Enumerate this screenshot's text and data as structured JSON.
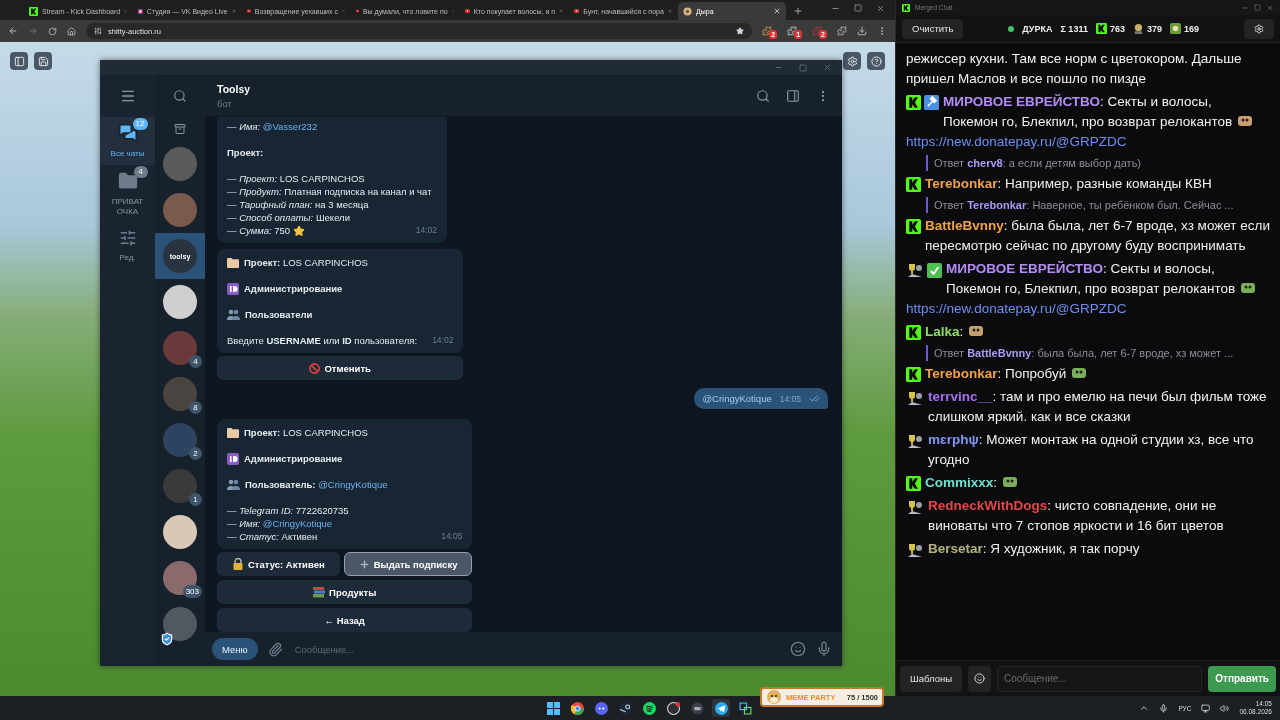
{
  "browser": {
    "tabs": [
      {
        "kind": "kick",
        "title": "Stream - Kick Dashboard",
        "selected": false
      },
      {
        "kind": "studio",
        "title": "Студия — VK Видео Live",
        "selected": false
      },
      {
        "kind": "video",
        "title": "Возвращение уехавших с",
        "selected": false
      },
      {
        "kind": "video",
        "title": "Вы думали, что ловите по",
        "selected": false
      },
      {
        "kind": "video",
        "title": "Кто покупает волосы, и п",
        "selected": false
      },
      {
        "kind": "video",
        "title": "Бунт, начавшийся с пора",
        "selected": false
      },
      {
        "kind": "page",
        "title": "Дыра",
        "selected": true
      }
    ],
    "address": "shitty-auction.ru",
    "extension_badges": [
      "2",
      "1",
      "2"
    ]
  },
  "telegram": {
    "folders": [
      {
        "kind": "chats",
        "label": "Все чаты",
        "badge": "12",
        "selected": true
      },
      {
        "kind": "folder",
        "label": "ПРИВАТ ОЧКА",
        "badge": "4",
        "selected": false
      },
      {
        "kind": "edit",
        "label": "Ред.",
        "selected": false
      }
    ],
    "chats": [
      {
        "kind": "photo",
        "selected": false
      },
      {
        "kind": "photo",
        "selected": false
      },
      {
        "kind": "logo",
        "logo": "toolsy",
        "selected": true
      },
      {
        "kind": "photo",
        "selected": false
      },
      {
        "kind": "photo",
        "unread": "4",
        "selected": false
      },
      {
        "kind": "photo",
        "unread": "8",
        "selected": false
      },
      {
        "kind": "photo",
        "unread": "2",
        "selected": false
      },
      {
        "kind": "photo",
        "unread": "1",
        "selected": false
      },
      {
        "kind": "photo",
        "selected": false
      },
      {
        "kind": "photo",
        "unread": "303",
        "selected": false
      },
      {
        "kind": "photo",
        "verified": true,
        "selected": false
      }
    ],
    "chat": {
      "title": "Toolsy",
      "subtitle": "бот",
      "messages": [
        {
          "kind": "incoming",
          "time": "14:02",
          "groups": [
            [
              {
                "kind": "field",
                "label": "— Имя:",
                "value": "@Vasser232",
                "link": true
              }
            ],
            [
              {
                "kind": "heading",
                "text": "Проект:"
              }
            ],
            [
              {
                "kind": "field",
                "label": "— Проект:",
                "value": "LOS CARPINCHOS",
                "link": false
              },
              {
                "kind": "field",
                "label": "— Продукт:",
                "value": "Платная подписка на канал и чат",
                "link": false
              },
              {
                "kind": "field",
                "label": "— Тарифный план:",
                "value": "на 3 месяца",
                "link": false
              },
              {
                "kind": "field",
                "label": "— Способ оплаты:",
                "value": "Шекели",
                "link": false
              },
              {
                "kind": "amount",
                "label": "— Сумма:",
                "value": "750",
                "link": false
              }
            ]
          ]
        },
        {
          "kind": "incoming",
          "time": "14:02",
          "groups": [
            [
              {
                "kind": "project",
                "label": "Проект:",
                "value": "LOS CARPINCHOS",
                "link": false
              }
            ],
            [
              {
                "kind": "section",
                "label": "Администрирование"
              }
            ],
            [
              {
                "kind": "users",
                "label": "Пользователи"
              }
            ],
            [
              {
                "kind": "prompt",
                "text": "Введите **USERNAME** или **ID** пользователя:"
              }
            ]
          ],
          "keyboard": [
            [
              {
                "kind": "cancel",
                "label": "Отменить",
                "hovered": false
              }
            ]
          ]
        },
        {
          "kind": "outgoing",
          "text": "@CringyKotique",
          "time": "14:05",
          "read": true
        },
        {
          "kind": "incoming",
          "time": "14:05",
          "groups": [
            [
              {
                "kind": "project",
                "label": "Проект:",
                "value": "LOS CARPINCHOS",
                "link": false
              }
            ],
            [
              {
                "kind": "section",
                "label": "Администрирование"
              }
            ],
            [
              {
                "kind": "users",
                "label": "Пользователь:",
                "value": "@CringyKotique",
                "link": true
              }
            ],
            [
              {
                "kind": "field",
                "label": "— Telegram ID:",
                "value": "7722620735",
                "link": false
              },
              {
                "kind": "field",
                "label": "— Имя:",
                "value": "@CringyKotique",
                "link": true
              },
              {
                "kind": "field",
                "label": "— Статус:",
                "value": "Активен",
                "link": false
              }
            ]
          ],
          "keyboard": [
            [
              {
                "kind": "status",
                "label": "Статус: Активен",
                "hovered": false
              },
              {
                "kind": "grant",
                "label": "Выдать подписку",
                "hovered": true
              }
            ],
            [
              {
                "kind": "products",
                "label": "Продукты",
                "hovered": false
              }
            ],
            [
              {
                "kind": "back",
                "label": "← Назад",
                "hovered": false
              }
            ]
          ]
        }
      ],
      "input": {
        "menu": "Меню",
        "placeholder": "Сообщение..."
      }
    }
  },
  "merged_chat": {
    "title": "Merged Chat",
    "clear": "Очистить",
    "status": {
      "label": "ДУРКА",
      "live": true
    },
    "stats": [
      {
        "kind": "sum",
        "value": "Σ 1311"
      },
      {
        "kind": "kick",
        "value": "763"
      },
      {
        "kind": "viewers",
        "value": "379"
      },
      {
        "kind": "followers",
        "value": "169"
      }
    ],
    "messages": [
      {
        "kind": "fragment",
        "text": "режиссер кухни. Там все норм с цветокором. Дальше пришел Маслов и все пошло по пизде"
      },
      {
        "kind": "kick-mod",
        "color": "#b48cf5",
        "text": "**МИРОВОЕ ЕВРЕЙСТВО**: Секты и волосы, Покемон го, Блекпил, про возврат релокантов",
        "emote": true,
        "link": "https://new.donatepay.ru/@GRPZDC"
      },
      {
        "kind": "reply",
        "color": "#a99bf5",
        "text": "Ответ **cherv8**: а если детям выбор дать)"
      },
      {
        "kind": "kick",
        "color": "#f0a24a",
        "text": "**Terebonkar**: Например, разные команды КВН",
        "emote": false
      },
      {
        "kind": "reply",
        "color": "#a99bf5",
        "text": "Ответ **Terebonkar**: Наверное, ты ребёнком был. Сейчас ..."
      },
      {
        "kind": "kick",
        "color": "#f0a24a",
        "text": "**BattleBvnny**: была была, лет 6-7 вроде, хз может если пересмотрю сейчас по другому буду воспринимать",
        "emote": false
      },
      {
        "kind": "badge-check",
        "color": "#b48cf5",
        "text": "**МИРОВОЕ ЕВРЕЙСТВО**: Секты и волосы, Покемон го, Блекпил, про возврат релокантов",
        "emote": true,
        "link": "https://new.donatepay.ru/@GRPZDC"
      },
      {
        "kind": "kick",
        "color": "#8ee06a",
        "text": "**Lalka**:",
        "emote": true
      },
      {
        "kind": "reply",
        "color": "#a99bf5",
        "text": "Ответ **BattleBvnny**: была была, лет 6-7 вроде, хз может ..."
      },
      {
        "kind": "kick",
        "color": "#f0a24a",
        "text": "**Terebonkar**: Попробуй",
        "emote": true
      },
      {
        "kind": "badge",
        "color": "#a56ff0",
        "text": "**terrvinc__**: там и про емелю на печи был фильм тоже слишком яркий. как и все сказки",
        "emote": false
      },
      {
        "kind": "badge",
        "color": "#7f96f5",
        "text": "**mɛrphψ**: Может монтаж на одной студии хз, все что угодно",
        "emote": false
      },
      {
        "kind": "kick",
        "color": "#6ee0cf",
        "text": "**Commixxx**:",
        "emote": true
      },
      {
        "kind": "badge",
        "color": "#e34848",
        "text": "**RedneckWithDogs**: чисто совпадение, они не виноваты что 7 стопов яркости и 16 бит цветов",
        "emote": false
      },
      {
        "kind": "badge",
        "color": "#b6b27a",
        "text": "**Bersetar**: Я художник, я так порчу",
        "emote": false
      }
    ],
    "templates": "Шаблоны",
    "placeholder": "Сообщение...",
    "send": "Отправить"
  },
  "taskbar": {
    "apps": [
      {
        "kind": "start"
      },
      {
        "kind": "browser"
      },
      {
        "kind": "voice"
      },
      {
        "kind": "game"
      },
      {
        "kind": "music"
      },
      {
        "kind": "record"
      },
      {
        "kind": "panel"
      },
      {
        "kind": "messenger"
      },
      {
        "kind": "capture"
      }
    ],
    "widget": {
      "title": "MEME PARTY",
      "counter": "75 / 1500"
    },
    "tray": {
      "language": "РУС",
      "time": "14:05",
      "date": "06.08.2026"
    }
  }
}
